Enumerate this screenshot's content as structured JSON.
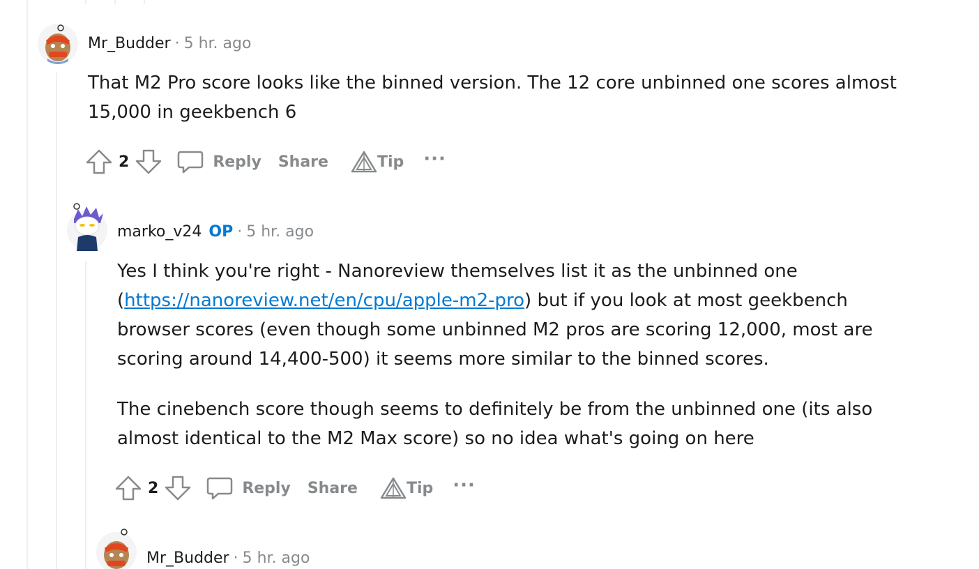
{
  "comments": [
    {
      "author": "Mr_Budder",
      "time": "5 hr. ago",
      "body": "That M2 Pro score looks like the binned version. The 12 core unbinned one scores almost 15,000 in geekbench 6",
      "votes": "2",
      "reply_label": "Reply",
      "share_label": "Share",
      "tip_label": "Tip",
      "more_label": "···"
    },
    {
      "author": "marko_v24",
      "flair": "OP",
      "time": "5 hr. ago",
      "body_p1_before": "Yes I think you're right - Nanoreview themselves list it as the unbinned one (",
      "link_text": "https://nanoreview.net/en/cpu/apple-m2-pro",
      "body_p1_after": ") but if you look at most geekbench browser scores (even though some unbinned M2 pros are scoring 12,000, most are scoring around 14,400-500) it seems more similar to the binned scores.",
      "body_p2": "The cinebench score though seems to definitely be from the unbinned one (its also almost identical to the M2 Max score) so no idea what's going on here",
      "votes": "2",
      "reply_label": "Reply",
      "share_label": "Share",
      "tip_label": "Tip",
      "more_label": "···"
    },
    {
      "author": "Mr_Budder",
      "time": "5 hr. ago"
    }
  ],
  "separator": "·",
  "colors": {
    "link": "#0079d3",
    "muted": "#878a8c",
    "text": "#1c1c1c",
    "thread": "#edeff1"
  }
}
